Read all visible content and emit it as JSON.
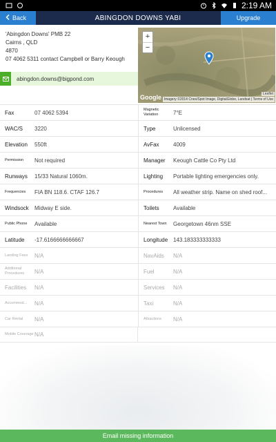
{
  "status_bar": {
    "time": "2:19 AM"
  },
  "header": {
    "back_label": "Back",
    "title": "ABINGDON DOWNS YABI",
    "upgrade_label": "Upgrade"
  },
  "contact": {
    "line1": "'Abingdon Downs' PMB 22",
    "line2": "Cairns , QLD",
    "line3": "4870",
    "line4": "07 4062 5311 contact Campbell or Barry Keough",
    "email": "abingdon.downs@bigpond.com"
  },
  "map": {
    "zoom_in": "+",
    "zoom_out": "−",
    "google": "Google",
    "credits": "Imagery ©2014 Cnes/Spot Image, DigitalGlobe, Landsat | Terms of Use",
    "leaflet": "Leaflet"
  },
  "rows": [
    {
      "l_label": "Fax",
      "l_value": "07 4062 5394",
      "r_label": "Magnetic Variation",
      "r_value": "7°E"
    },
    {
      "l_label": "WAC/S",
      "l_value": "3220",
      "r_label": "Type",
      "r_value": "Unlicensed"
    },
    {
      "l_label": "Elevation",
      "l_value": "550ft",
      "r_label": "AvFax",
      "r_value": "4009"
    },
    {
      "l_label": "Permission",
      "l_value": "Not required",
      "r_label": "Manager",
      "r_value": "Keough Cattle Co Pty Ltd"
    },
    {
      "l_label": "Runways",
      "l_value": "15/33 Natural 1060m.",
      "r_label": "Lighting",
      "r_value": "Portable lighting emergencies only."
    },
    {
      "l_label": "Frequencies",
      "l_value": "FIA BN 118.6. CTAF 126.7",
      "r_label": "Procedures",
      "r_value": "All weather strip. Name on shed roof..."
    },
    {
      "l_label": "Windsock",
      "l_value": "Midway E side.",
      "r_label": "Toilets",
      "r_value": "Available"
    },
    {
      "l_label": "Public Phone",
      "l_value": "Available",
      "r_label": "Nearest Town",
      "r_value": "Georgetown 46nm SSE"
    },
    {
      "l_label": "Latitude",
      "l_value": "-17.6166666666667",
      "r_label": "Longitude",
      "r_value": "143.183333333333"
    }
  ],
  "na_rows": [
    {
      "l_label": "Landing Fees",
      "l_value": "N/A",
      "r_label": "NavAids",
      "r_value": "N/A"
    },
    {
      "l_label": "Additional Procedures",
      "l_value": "N/A",
      "r_label": "Fuel",
      "r_value": "N/A"
    },
    {
      "l_label": "Facilities",
      "l_value": "N/A",
      "r_label": "Services",
      "r_value": "N/A"
    },
    {
      "l_label": "Accommod...",
      "l_value": "N/A",
      "r_label": "Taxi",
      "r_value": "N/A"
    },
    {
      "l_label": "Car Rental",
      "l_value": "N/A",
      "r_label": "Attractions",
      "r_value": "N/A"
    },
    {
      "l_label": "Mobile Coverage",
      "l_value": "N/A",
      "r_label": "",
      "r_value": ""
    }
  ],
  "footer": {
    "email_missing_label": "Email missing information"
  }
}
